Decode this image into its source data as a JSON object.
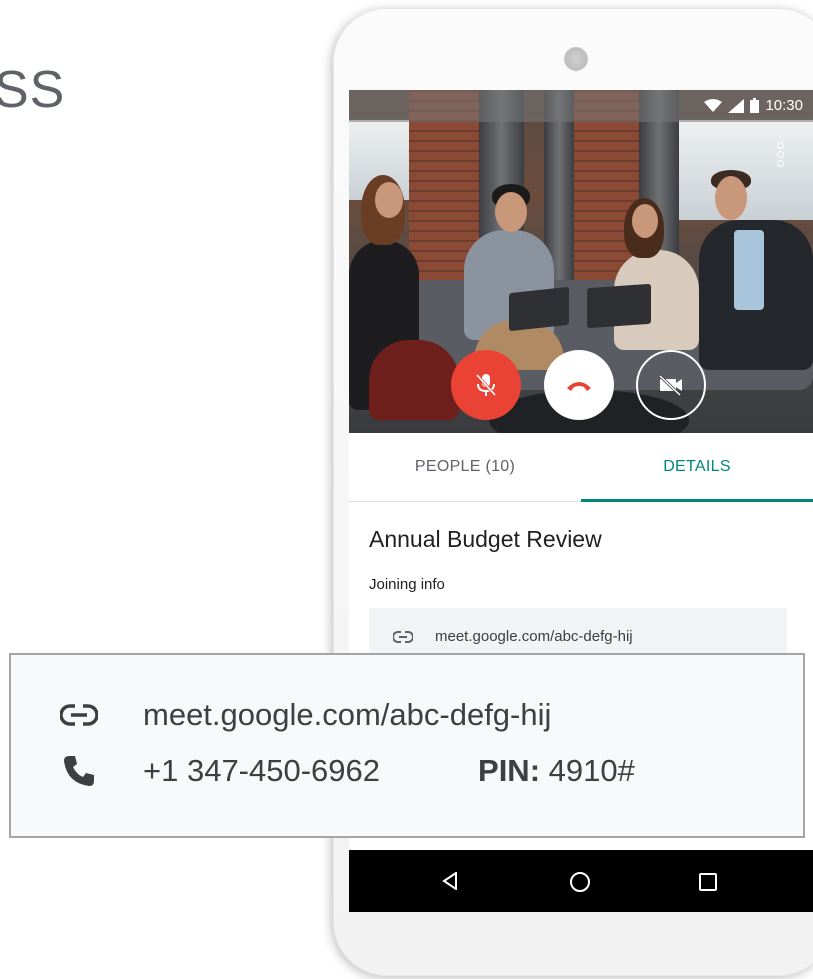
{
  "background_word": "SS",
  "status_bar": {
    "time": "10:30"
  },
  "tabs": [
    {
      "label": "PEOPLE (10)",
      "active": false
    },
    {
      "label": "DETAILS",
      "active": true
    }
  ],
  "accent_color": "#00897b",
  "end_call_color": "#ea4335",
  "meeting": {
    "title": "Annual Budget Review",
    "joining_label": "Joining info",
    "link": "meet.google.com/abc-defg-hij"
  },
  "callout": {
    "link": "meet.google.com/abc-defg-hij",
    "phone": "+1 347-450-6962",
    "pin_label": "PIN:",
    "pin_value": " 4910#"
  },
  "icons": [
    "link-icon",
    "phone-icon",
    "mic-off-icon",
    "call-end-icon",
    "videocam-off-icon",
    "more-vert-icon",
    "wifi-icon",
    "signal-icon",
    "battery-icon",
    "back-icon",
    "home-icon",
    "recents-icon"
  ]
}
